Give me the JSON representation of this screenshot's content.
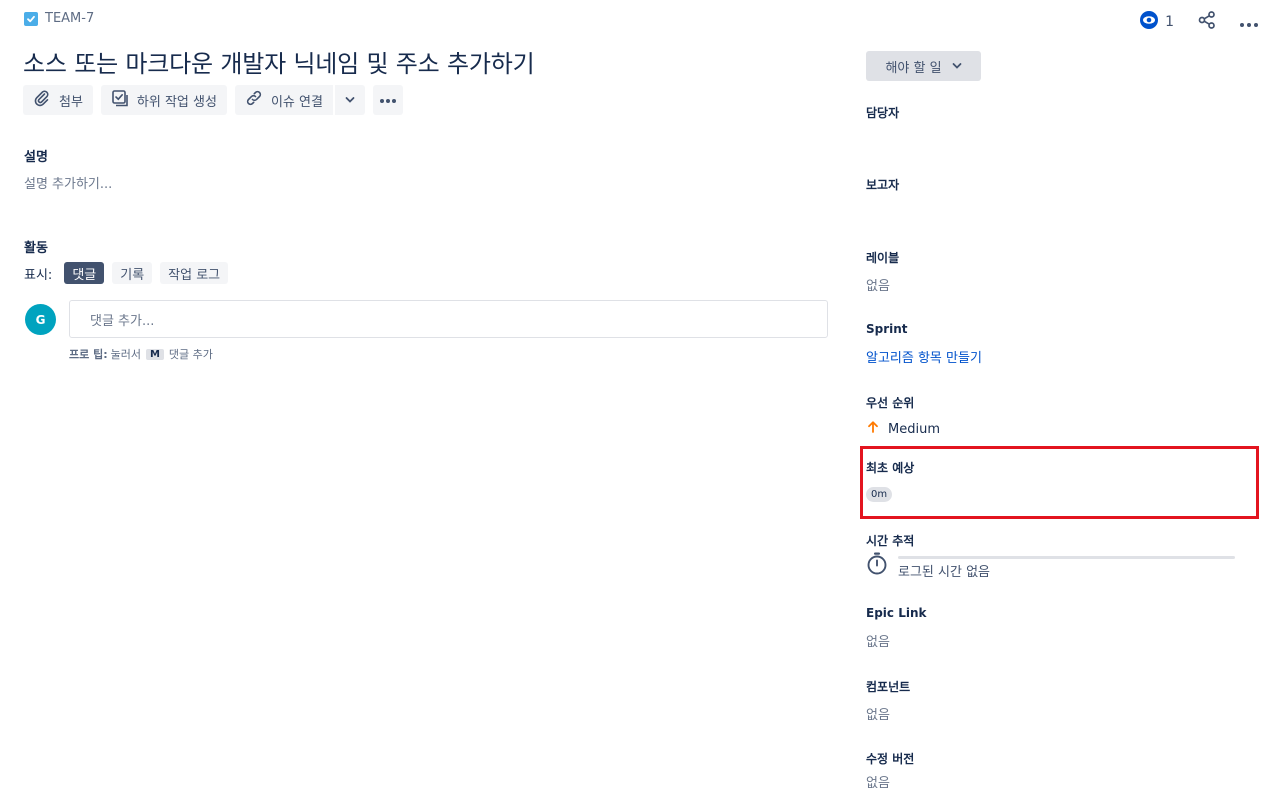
{
  "breadcrumb": {
    "issue_key": "TEAM-7"
  },
  "header": {
    "watch_count": "1"
  },
  "issue": {
    "title": "소스 또는 마크다운 개발자 닉네임 및 주소 추가하기"
  },
  "toolbar": {
    "attach": "첨부",
    "subtask": "하위 작업 생성",
    "link": "이슈 연결"
  },
  "description": {
    "label": "설명",
    "placeholder": "설명 추가하기..."
  },
  "activity": {
    "label": "활동",
    "show_label": "표시:",
    "tabs": [
      "댓글",
      "기록",
      "작업 로그"
    ]
  },
  "comment": {
    "avatar_initial": "G",
    "placeholder": "댓글 추가...",
    "tip_prefix": "프로 팁:",
    "tip_middle": "눌러서",
    "tip_key": "M",
    "tip_suffix": "댓글 추가"
  },
  "sidebar": {
    "status": "해야 할 일",
    "assignee_label": "담당자",
    "reporter_label": "보고자",
    "labels_label": "레이블",
    "labels_value": "없음",
    "sprint_label": "Sprint",
    "sprint_value": "알고리즘 항목 만들기",
    "priority_label": "우선 순위",
    "priority_value": "Medium",
    "estimate_label": "최초 예상",
    "estimate_value": "0m",
    "time_tracking_label": "시간 추적",
    "time_tracking_value": "로그된 시간 없음",
    "epic_label": "Epic Link",
    "epic_value": "없음",
    "components_label": "컴포넌트",
    "components_value": "없음",
    "fix_version_label": "수정 버전",
    "fix_version_value": "없음"
  },
  "colors": {
    "accent": "#0052cc",
    "highlight": "#e3141f",
    "priority_medium": "#ff7a00",
    "avatar": "#00a3bf"
  }
}
